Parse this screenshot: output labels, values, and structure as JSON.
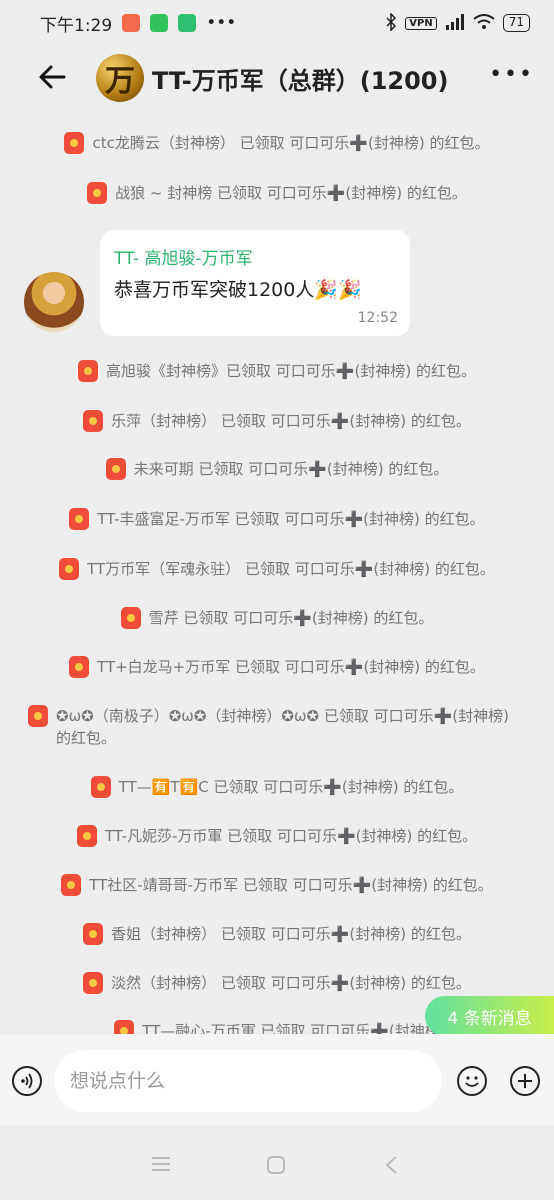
{
  "status": {
    "time": "下午1:29",
    "vpn": "VPN",
    "battery": "71"
  },
  "header": {
    "avatar_text": "万",
    "title": "TT-万币军（总群）(1200)"
  },
  "messages": [
    {
      "text": "ctc龙腾云（封神榜） 已领取 可口可乐➕(封神榜) 的红包。"
    },
    {
      "text": "战狼 ~ 封神榜 已领取 可口可乐➕(封神榜) 的红包。"
    },
    {
      "text": "高旭骏《封神榜》已领取 可口可乐➕(封神榜) 的红包。"
    },
    {
      "text": "乐萍（封神榜） 已领取 可口可乐➕(封神榜) 的红包。"
    },
    {
      "text": "未来可期 已领取 可口可乐➕(封神榜) 的红包。"
    },
    {
      "text": "TT-丰盛富足-万币军 已领取 可口可乐➕(封神榜) 的红包。"
    },
    {
      "text": "TT万币军（军魂永驻） 已领取 可口可乐➕(封神榜) 的红包。"
    },
    {
      "text": "雪芹 已领取 可口可乐➕(封神榜) 的红包。"
    },
    {
      "text": "TT+白龙马+万币军 已领取 可口可乐➕(封神榜) 的红包。"
    },
    {
      "text": "✪ω✪（南极子）✪ω✪（封神榜）✪ω✪ 已领取 可口可乐➕(封神榜) 的红包。"
    },
    {
      "text": "TT—🈶T🈶C 已领取 可口可乐➕(封神榜) 的红包。"
    },
    {
      "text": "TT-凡妮莎-万币軍 已领取 可口可乐➕(封神榜) 的红包。"
    },
    {
      "text": "TT社区-靖哥哥-万币军 已领取 可口可乐➕(封神榜) 的红包。"
    },
    {
      "text": "香姐（封神榜） 已领取 可口可乐➕(封神榜) 的红包。"
    },
    {
      "text": "淡然（封神榜） 已领取 可口可乐➕(封神榜) 的红包。"
    },
    {
      "text": "TT—融心-万币軍 已领取 可口可乐➕(封神榜"
    }
  ],
  "chat_message": {
    "sender": "TT- 高旭骏-万币军",
    "text": "恭喜万币军突破1200人🎉🎉",
    "time": "12:52"
  },
  "new_messages": "4 条新消息",
  "input": {
    "placeholder": "想说点什么"
  }
}
